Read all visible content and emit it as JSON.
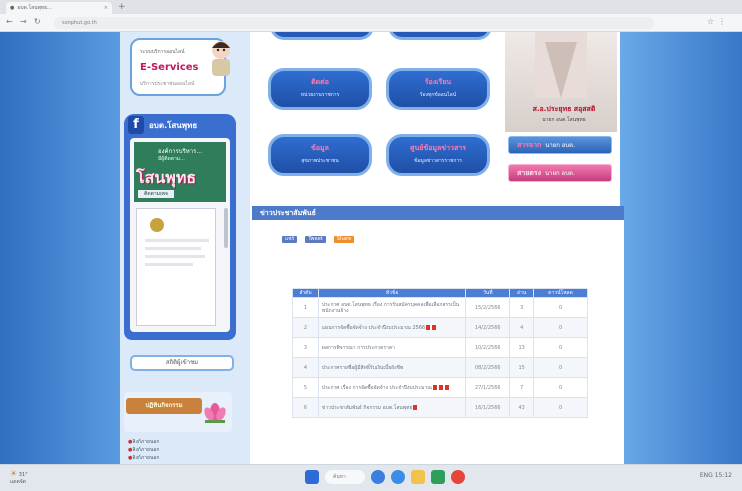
{
  "browser": {
    "tab_title": "อบต.โสนพุทธ...",
    "tab_close": "×",
    "new_tab": "+",
    "url": "sonphut.go.th"
  },
  "left": {
    "eservice_small": "ระบบบริการออนไลน์",
    "eservice_title": "E-Services",
    "eservice_sub": "บริการประชาชนออนไลน์",
    "fb_icon": "f",
    "fb_title": "อบต.โสนพุทธ",
    "fb_page_name": "องค์การบริหาร...",
    "fb_likes": "มีผู้ติดตาม...",
    "fb_banner": "โสนพุทธ",
    "fb_follow": "ติดตามเพจ",
    "visitor": "สถิติผู้เข้าชม",
    "lotus_band": "ปฏิทินกิจกรรม",
    "links": [
      "ลิงก์ภายนอก",
      "ลิงก์ภายนอก",
      "ลิงก์ภายนอก"
    ]
  },
  "services": [
    {
      "t1": "ติดต่อ",
      "t2": "หน่วยงานราชการ"
    },
    {
      "t1": "ร้องเรียน",
      "t2": "ร้องทุกข์ออนไลน์"
    },
    {
      "t1": "ข้อมูล",
      "t2": "สุขภาพประชาชน"
    },
    {
      "t1": "ศูนย์ข้อมูลข่าวสาร",
      "t2": "ข้อมูลข่าวสารราชการ"
    }
  ],
  "mayor": {
    "name": "ส.อ.ประยุทธ สอุสสติ",
    "position": "นายก อบต.โสนพุทธ",
    "btn1_accent": "สารจาก",
    "btn1_label": "นายก อบต.",
    "btn2_accent": "สายตรง",
    "btn2_label": "นายก อบต."
  },
  "news": {
    "header": "ข่าวประชาสัมพันธ์",
    "share": [
      "แชร์",
      "Tweet",
      "Share"
    ],
    "columns": [
      "ลำดับ",
      "หัวข้อ",
      "วันที่",
      "อ่าน",
      "ดาวน์โหลด"
    ],
    "rows": [
      {
        "no": "1",
        "title": "ประกาศ อบต.โสนพุทธ เรื่อง การรับสมัครบุคคลเพื่อเลือกสรรเป็นพนักงานจ้าง",
        "date": "15/2/2566",
        "reads": "3",
        "dl": "0",
        "pdfs": 0
      },
      {
        "no": "2",
        "title": "แผนการจัดซื้อจัดจ้าง ประจำปีงบประมาณ 2566",
        "date": "14/2/2566",
        "reads": "4",
        "dl": "0",
        "pdfs": 2
      },
      {
        "no": "3",
        "title": "ผลการพิจารณา การประกวดราคา",
        "date": "10/2/2566",
        "reads": "13",
        "dl": "0",
        "pdfs": 0
      },
      {
        "no": "4",
        "title": "ประกาศรายชื่อผู้มีสิทธิ์รับเงินเบี้ยยังชีพ",
        "date": "08/2/2566",
        "reads": "15",
        "dl": "0",
        "pdfs": 0
      },
      {
        "no": "5",
        "title": "ประกาศ เรื่อง การจัดซื้อจัดจ้าง ประจำปีงบประมาณ",
        "date": "27/1/2566",
        "reads": "7",
        "dl": "0",
        "pdfs": 3
      },
      {
        "no": "6",
        "title": "ข่าวประชาสัมพันธ์ กิจกรรม อบต.โสนพุทธ",
        "date": "16/1/2566",
        "reads": "43",
        "dl": "0",
        "pdfs": 1
      }
    ]
  },
  "taskbar": {
    "temp": "31°",
    "weather": "แดดจัด",
    "search": "ค้นหา",
    "tray": "ENG  15:12"
  }
}
